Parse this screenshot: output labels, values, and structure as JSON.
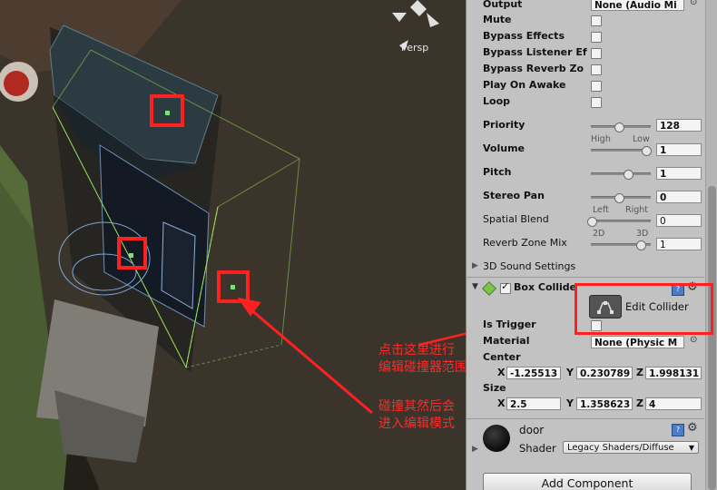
{
  "scene": {
    "persp_label": "Persp"
  },
  "annotations": {
    "line1": "点击这里进行",
    "line2": "编辑碰撞器范围",
    "line3": "碰撞其然后会",
    "line4": "进入编辑模式"
  },
  "audio": {
    "output_label": "Output",
    "output_value": "None (Audio Mi",
    "mute_label": "Mute",
    "bypass_effects_label": "Bypass Effects",
    "bypass_listener_label": "Bypass Listener Ef",
    "bypass_reverb_label": "Bypass Reverb Zo",
    "play_on_awake_label": "Play On Awake",
    "loop_label": "Loop",
    "priority_label": "Priority",
    "priority_value": "128",
    "priority_tick_low": "High",
    "priority_tick_high": "Low",
    "volume_label": "Volume",
    "volume_value": "1",
    "pitch_label": "Pitch",
    "pitch_value": "1",
    "stereo_pan_label": "Stereo Pan",
    "stereo_pan_value": "0",
    "stereo_tick_left": "Left",
    "stereo_tick_right": "Right",
    "spatial_blend_label": "Spatial Blend",
    "spatial_blend_value": "0",
    "spatial_tick_left": "2D",
    "spatial_tick_right": "3D",
    "reverb_mix_label": "Reverb Zone Mix",
    "reverb_mix_value": "1",
    "sound_settings_label": "3D Sound Settings",
    "slider_levels": {
      "priority": 0.5,
      "volume": 1.0,
      "pitch": 0.67,
      "stereo_pan": 0.5,
      "spatial_blend": 0.0,
      "reverb_mix": 0.9
    }
  },
  "box_collider": {
    "title": "Box Collide",
    "edit_collider_label": "Edit Collider",
    "is_trigger_label": "Is Trigger",
    "material_label": "Material",
    "material_value": "None (Physic M",
    "center_label": "Center",
    "center_x": "-1.25513",
    "center_y": "0.230789",
    "center_z": "1.998131",
    "size_label": "Size",
    "size_x": "2.5",
    "size_y": "1.358623",
    "size_z": "4",
    "axis_x": "X",
    "axis_y": "Y",
    "axis_z": "Z"
  },
  "material": {
    "name": "door",
    "shader_label": "Shader",
    "shader_value": "Legacy Shaders/Diffuse"
  },
  "add_component_label": "Add Component",
  "colors": {
    "annotation_red": "#ff2020",
    "inspector_bg": "#c2c2c2",
    "collider_green": "#9be35a"
  }
}
